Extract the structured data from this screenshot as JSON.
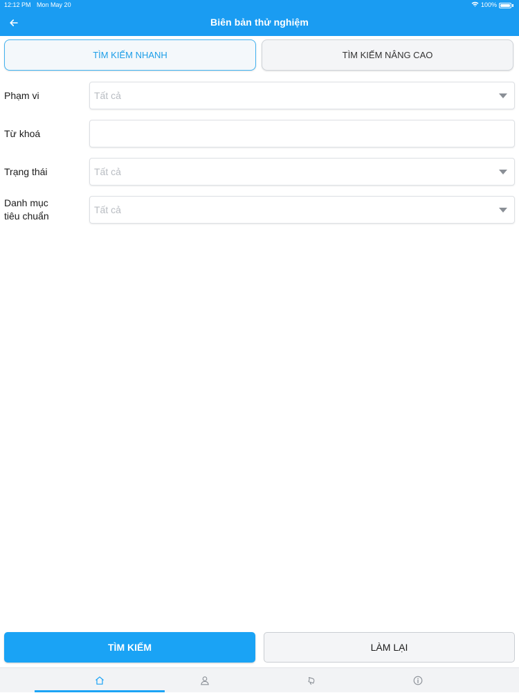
{
  "status_bar": {
    "time": "12:12 PM",
    "date": "Mon May 20",
    "battery": "100%"
  },
  "header": {
    "title": "Biên bản thử nghiệm"
  },
  "tabs": [
    {
      "label": "TÌM KIẾM NHANH",
      "active": true
    },
    {
      "label": "TÌM KIẾM NÂNG CAO",
      "active": false
    }
  ],
  "form": {
    "scope": {
      "label": "Phạm vi",
      "placeholder": "Tất cả"
    },
    "keyword": {
      "label": "Từ khoá",
      "value": ""
    },
    "status": {
      "label": "Trạng thái",
      "placeholder": "Tất cả"
    },
    "category": {
      "label_line1": "Danh mục",
      "label_line2": "tiêu chuẩn",
      "placeholder": "Tất cả"
    }
  },
  "actions": {
    "search_label": "TÌM KIẾM",
    "reset_label": "LÀM LẠI"
  },
  "bottom_nav": [
    "home-icon",
    "user-icon",
    "bell-icon",
    "info-icon"
  ],
  "colors": {
    "primary": "#1a9cf2",
    "accent": "#1aa3f5",
    "placeholder": "#b8bcc2"
  }
}
